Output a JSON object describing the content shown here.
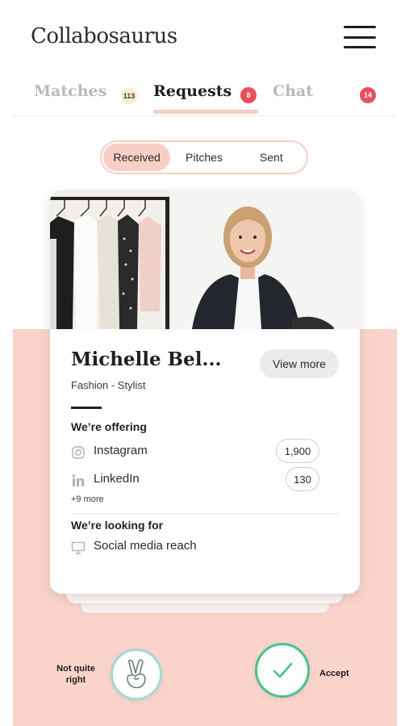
{
  "app": {
    "title": "Collabosaurus"
  },
  "tabs": [
    {
      "label": "Matches",
      "badge": "113",
      "active": false
    },
    {
      "label": "Requests",
      "badge": "8",
      "active": true
    },
    {
      "label": "Chat",
      "badge": "14",
      "active": false
    }
  ],
  "segmented": {
    "options": [
      "Received",
      "Pitches",
      "Sent"
    ],
    "selected": "Received"
  },
  "profile": {
    "name": "Michelle Bel...",
    "category": "Fashion - Stylist",
    "view_more_label": "View more",
    "offering_heading": "We’re offering",
    "offering": [
      {
        "icon": "instagram-icon",
        "label": "Instagram",
        "value": "1,900"
      },
      {
        "icon": "linkedin-icon",
        "label": "LinkedIn",
        "value": "130"
      }
    ],
    "more_label": "+9 more",
    "looking_heading": "We’re looking for",
    "looking": [
      {
        "icon": "monitor-icon",
        "label": "Social media reach"
      }
    ]
  },
  "actions": {
    "decline_label": "Not quite right",
    "accept_label": "Accept"
  },
  "colors": {
    "accent_pink": "#fad4ca",
    "badge_red": "#e8505b",
    "accept_green": "#4cc08a",
    "decline_teal": "#a6d7d5"
  }
}
